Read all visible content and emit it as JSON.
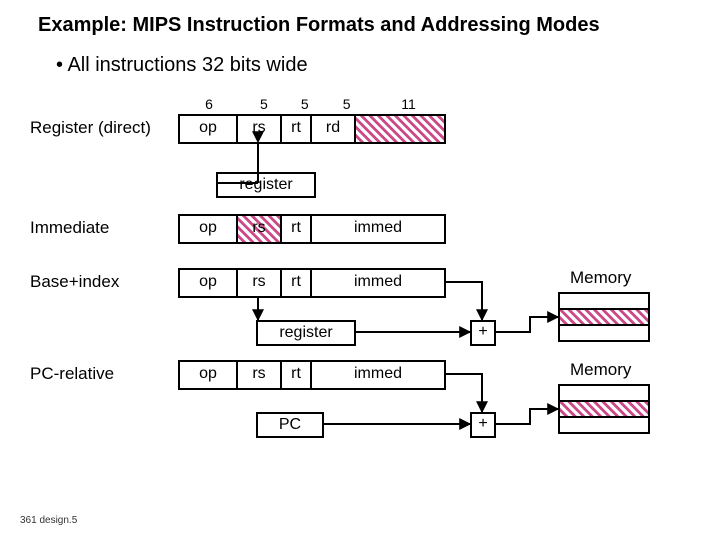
{
  "title": "Example: MIPS Instruction Formats and Addressing Modes",
  "bullet": "• All instructions 32 bits wide",
  "bits": {
    "w0": "6",
    "w1": "5",
    "w2": "5",
    "w3": "5",
    "w4": "11"
  },
  "fields": {
    "op": "op",
    "rs": "rs",
    "rt": "rt",
    "rd": "rd",
    "immed": "immed"
  },
  "modes": {
    "register_direct": "Register (direct)",
    "immediate": "Immediate",
    "base_index": "Base+index",
    "pc_relative": "PC-relative"
  },
  "boxes": {
    "register": "register",
    "pc": "PC"
  },
  "adder": "+",
  "memory_label": "Memory",
  "footnote": "361 design.5"
}
